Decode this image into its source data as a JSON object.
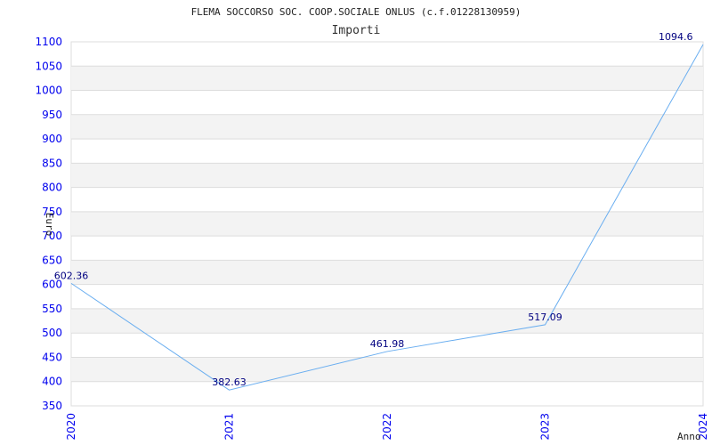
{
  "chart_data": {
    "type": "line",
    "title": "FLEMA SOCCORSO SOC. COOP.SOCIALE ONLUS (c.f.01228130959)",
    "subtitle": "Importi",
    "xlabel": "Anno",
    "ylabel": "Euro",
    "categories": [
      "2020",
      "2021",
      "2022",
      "2023",
      "2024"
    ],
    "values": [
      602.36,
      382.63,
      461.98,
      517.09,
      1094.6
    ],
    "data_labels": [
      "602.36",
      "382.63",
      "461.98",
      "517.09",
      "1094.6"
    ],
    "ylim": [
      350,
      1100
    ],
    "yticks": [
      350,
      400,
      450,
      500,
      550,
      600,
      650,
      700,
      750,
      800,
      850,
      900,
      950,
      1000,
      1050,
      1100
    ],
    "grid": true,
    "colors": {
      "line": "#6aaef0",
      "tick": "#0000ee",
      "label": "#000080",
      "band": "#f3f3f3",
      "grid": "#dddddd"
    }
  }
}
